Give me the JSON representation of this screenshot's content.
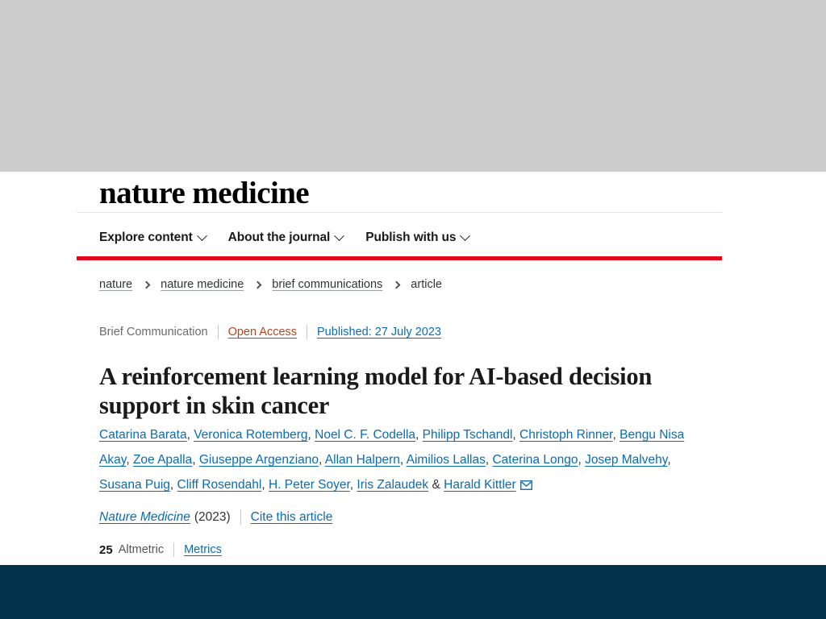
{
  "colors": {
    "brand_red": "#e3051b",
    "link_blue": "#0b6cb2",
    "open_access_orange": "#b4451f",
    "footer_navy": "#01324b",
    "chrome_grey": "#cccccc"
  },
  "masthead": {
    "journal_logo": "nature medicine"
  },
  "nav": {
    "items": [
      {
        "label": "Explore content",
        "icon": "chevron-down-icon"
      },
      {
        "label": "About the journal",
        "icon": "chevron-down-icon"
      },
      {
        "label": "Publish with us",
        "icon": "chevron-down-icon"
      }
    ]
  },
  "breadcrumb": {
    "items": [
      {
        "label": "nature",
        "is_link": true
      },
      {
        "label": "nature medicine",
        "is_link": true
      },
      {
        "label": "brief communications",
        "is_link": true
      },
      {
        "label": "article",
        "is_link": false
      }
    ]
  },
  "article": {
    "type": "Brief Communication",
    "access": "Open Access",
    "published": "Published: 27 July 2023",
    "title": "A reinforcement learning model for AI-based decision support in skin cancer",
    "authors": [
      "Catarina Barata",
      "Veronica Rotemberg",
      "Noel C. F. Codella",
      "Philipp Tschandl",
      "Christoph Rinner",
      "Bengu Nisa Akay",
      "Zoe Apalla",
      "Giuseppe Argenziano",
      "Allan Halpern",
      "Aimilios Lallas",
      "Caterina Longo",
      "Josep Malvehy",
      "Susana Puig",
      "Cliff Rosendahl",
      "H. Peter Soyer",
      "Iris Zalaudek",
      "Harald Kittler"
    ],
    "corresponding_author_icon": "envelope-icon",
    "ampersand": "&",
    "citation_journal": "Nature Medicine",
    "citation_year": "(2023)",
    "cite_link": "Cite this article",
    "altmetric_count": "25",
    "altmetric_label": "Altmetric",
    "metrics_link": "Metrics"
  }
}
